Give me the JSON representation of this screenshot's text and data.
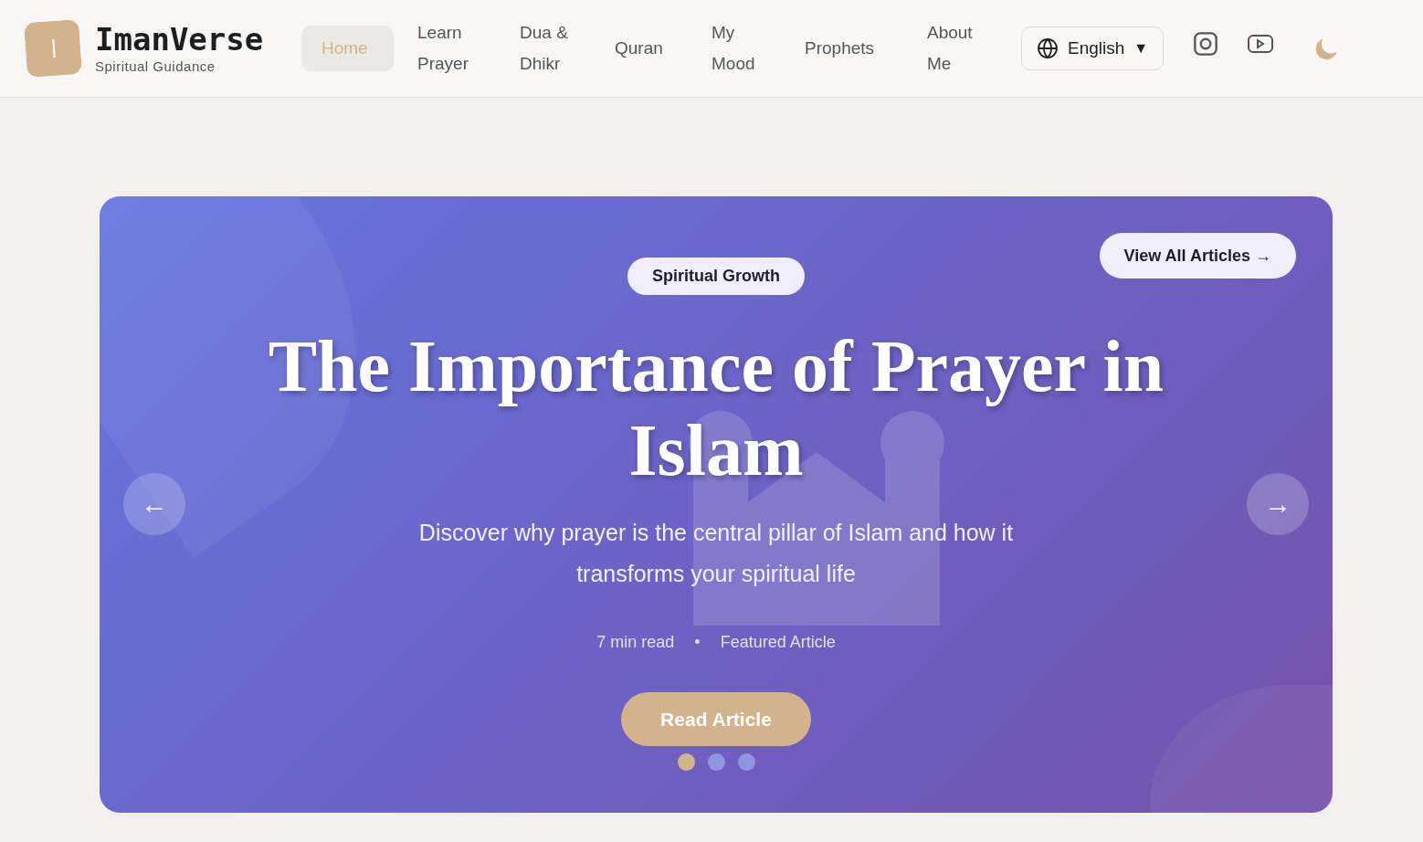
{
  "brand": {
    "name": "ImanVerse",
    "tagline": "Spiritual Guidance"
  },
  "nav": [
    {
      "label": "Home",
      "selected": true
    },
    {
      "label": "Learn Prayer",
      "selected": false
    },
    {
      "label": "Dua & Dhikr",
      "selected": false
    },
    {
      "label": "Quran",
      "selected": false
    },
    {
      "label": "My Mood",
      "selected": false
    },
    {
      "label": "Prophets",
      "selected": false
    },
    {
      "label": "About Me",
      "selected": false
    }
  ],
  "language": {
    "value": "English",
    "caret": "▼"
  },
  "hero": {
    "category": "Spiritual Growth",
    "view_all": "View All Articles →",
    "title": "The Importance of Prayer in Islam",
    "description": "Discover why prayer is the central pillar of Islam and how it transforms your spiritual life",
    "read_time": "7 min read",
    "separator": "•",
    "label": "Featured Article",
    "cta": "Read Article",
    "prev": "←",
    "next": "→",
    "dots": [
      {
        "selected": true
      },
      {
        "selected": false
      },
      {
        "selected": false
      }
    ]
  }
}
